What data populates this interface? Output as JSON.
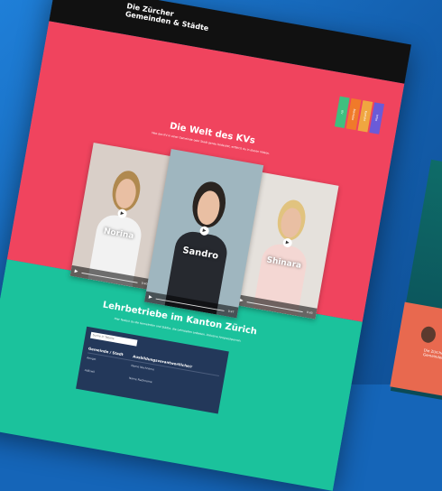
{
  "site": {
    "logo_line1": "Die Zürcher",
    "logo_line2": "Gemeinden & Städte"
  },
  "nav_tabs": [
    {
      "label": "KV",
      "color": "#3fbf7f"
    },
    {
      "label": "Betriebe",
      "color": "#f07a2a"
    },
    {
      "label": "Kontakt",
      "color": "#f0a640"
    },
    {
      "label": "Infos",
      "color": "#6a5bd8"
    }
  ],
  "hero": {
    "title": "Die Welt des KVs",
    "subtitle": "Was das KV in einer Gemeinde oder Stadt genau bedeutet, erfährst du in diesen Videos."
  },
  "videos": [
    {
      "name": "Norina",
      "time": "0:40",
      "hair": "#b0894f",
      "shirt": "#f2f2f2",
      "bg": "#d9cfc8"
    },
    {
      "name": "Sandro",
      "time": "0:47",
      "hair": "#2a2420",
      "shirt": "#26292f",
      "bg": "#9fb6bf"
    },
    {
      "name": "Shinara",
      "time": "0:43",
      "hair": "#e1c37f",
      "shirt": "#f4d7d3",
      "bg": "#e5e1dc"
    }
  ],
  "carousel": {
    "count": 3,
    "active": 1
  },
  "companies": {
    "title": "Lehrbetriebe im Kanton Zürich",
    "subtitle": "Hier findest du die Gemeinden und Städte, die Lehrstellen anbieten, inklusive Ansprechperson.",
    "search_placeholder": "Suche in Tabelle",
    "col_1": "Gemeinde / Stadt",
    "col_2": "Ausbildungsverantwortliche/r",
    "rows": [
      {
        "place": "Aeugst",
        "contact": "Name Nachname"
      },
      {
        "place": "Adliswil",
        "contact": "Name Nachname"
      }
    ]
  },
  "side_preview": {
    "text": "Die Zürcher Gemeinden"
  }
}
